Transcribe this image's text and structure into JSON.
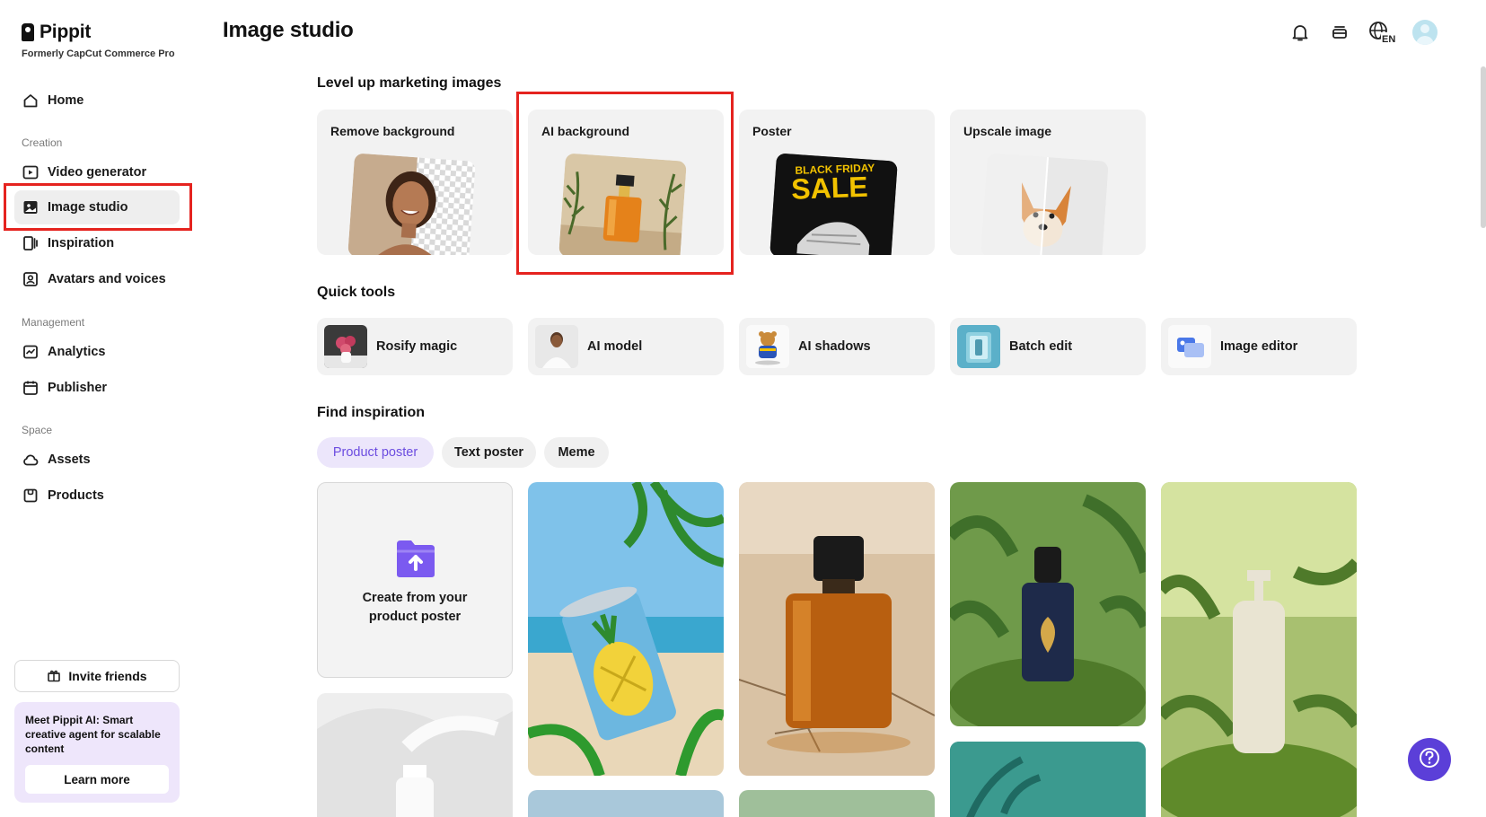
{
  "brand": {
    "name": "Pippit",
    "subtitle": "Formerly CapCut Commerce Pro"
  },
  "sidebar": {
    "home": "Home",
    "sections": {
      "creation": "Creation",
      "management": "Management",
      "space": "Space"
    },
    "items": {
      "video_generator": "Video generator",
      "image_studio": "Image studio",
      "inspiration": "Inspiration",
      "avatars": "Avatars and voices",
      "analytics": "Analytics",
      "publisher": "Publisher",
      "assets": "Assets",
      "products": "Products"
    },
    "invite": "Invite friends",
    "promo": {
      "text": "Meet Pippit AI: Smart creative agent for scalable content",
      "button": "Learn more"
    }
  },
  "header": {
    "title": "Image studio",
    "language_badge": "EN"
  },
  "level_up": {
    "title": "Level up marketing images",
    "cards": [
      "Remove background",
      "AI background",
      "Poster",
      "Upscale image"
    ],
    "poster_art": {
      "line1": "BLACK FRIDAY",
      "line2": "SALE"
    }
  },
  "quick_tools": {
    "title": "Quick tools",
    "items": [
      "Rosify magic",
      "AI model",
      "AI shadows",
      "Batch edit",
      "Image editor"
    ]
  },
  "inspiration": {
    "title": "Find inspiration",
    "tabs": [
      "Product poster",
      "Text poster",
      "Meme"
    ],
    "active_tab": "Product poster",
    "create_text": "Create from your product poster"
  },
  "colors": {
    "accent": "#5b3fd8",
    "highlight": "#e5231f",
    "active_pill_bg": "#ece6fb"
  }
}
